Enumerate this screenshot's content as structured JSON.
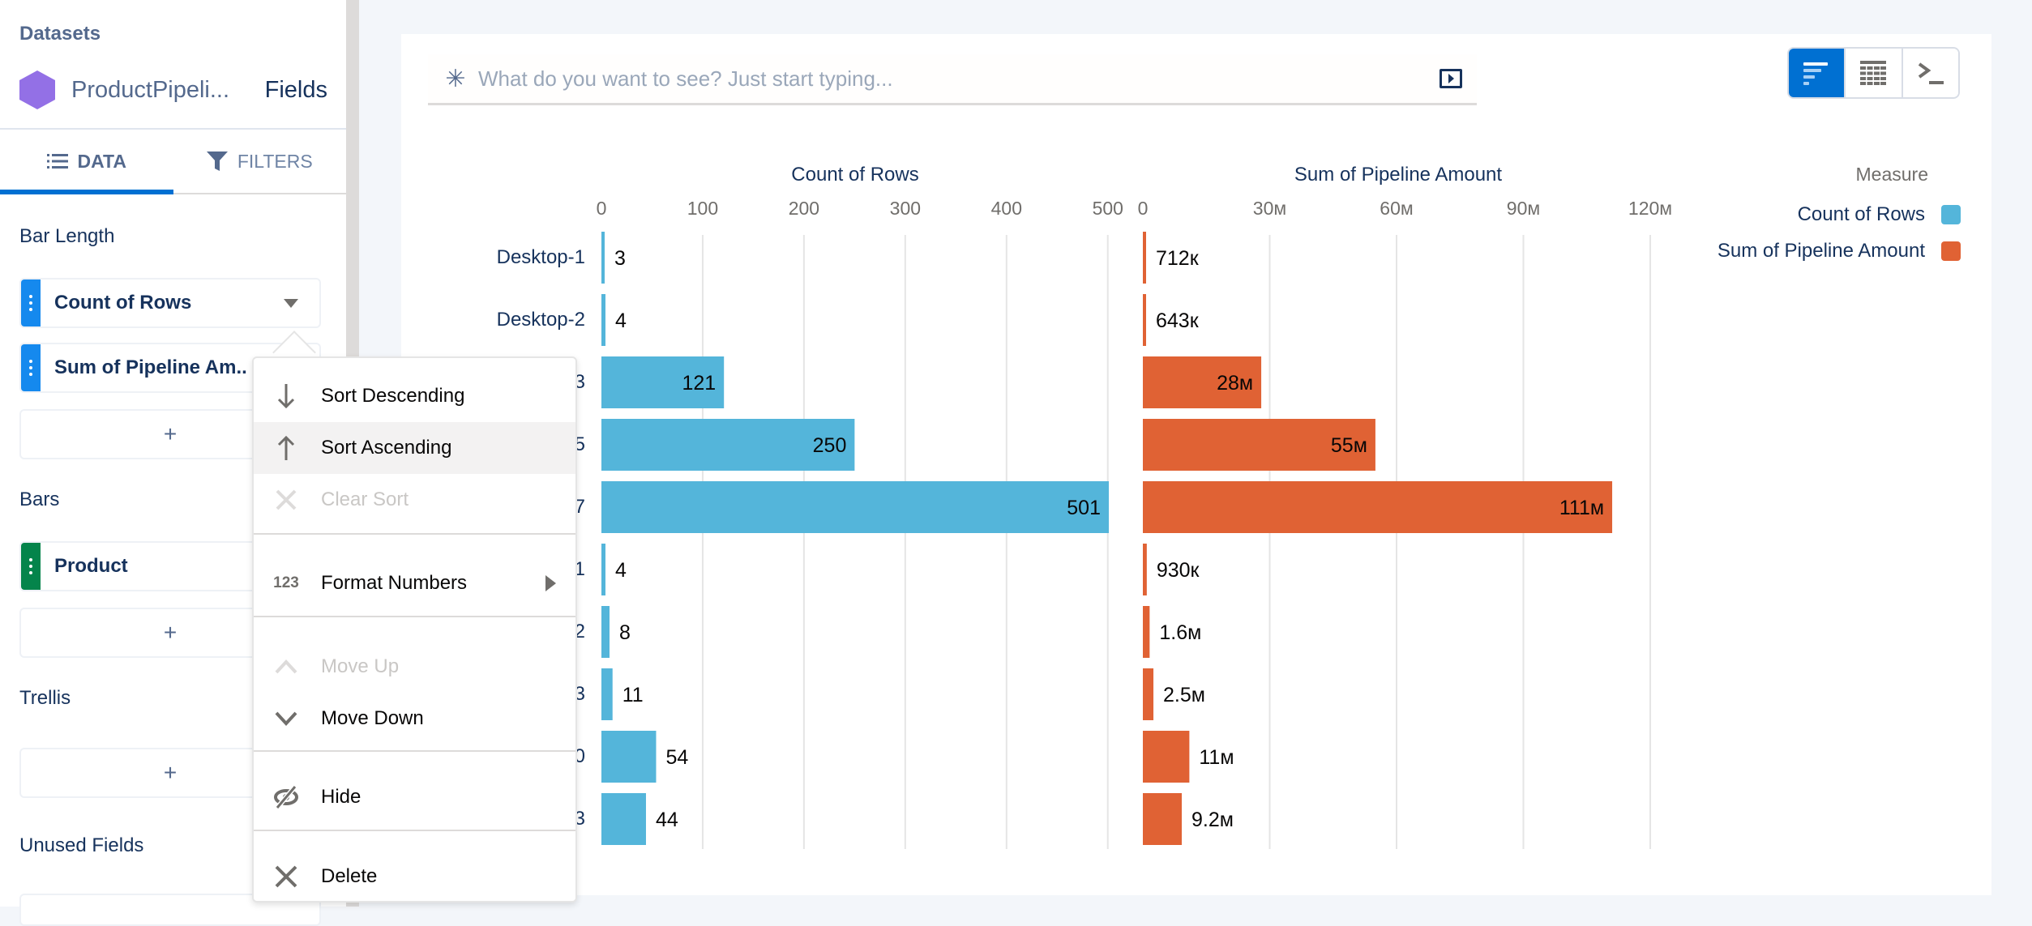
{
  "sidebar": {
    "datasets_label": "Datasets",
    "dataset_name": "ProductPipeli...",
    "fields_link": "Fields",
    "tabs": [
      {
        "label": "DATA",
        "icon": "list-icon",
        "active": true
      },
      {
        "label": "FILTERS",
        "icon": "filter-icon",
        "active": false
      }
    ],
    "sections": {
      "bar_length": {
        "label": "Bar Length",
        "fields": [
          {
            "label": "Count of Rows",
            "color": "#1589ee"
          },
          {
            "label": "Sum of Pipeline Am..",
            "color": "#1589ee"
          }
        ],
        "add_label": "+"
      },
      "bars": {
        "label": "Bars",
        "fields": [
          {
            "label": "Product",
            "color": "#04844b"
          }
        ],
        "add_label": "+"
      },
      "trellis": {
        "label": "Trellis",
        "add_label": "+"
      },
      "unused": {
        "label": "Unused Fields"
      }
    }
  },
  "search": {
    "placeholder": "What do you want to see? Just start typing...",
    "value": ""
  },
  "view_toggle": [
    {
      "name": "chart-view",
      "icon": "bar-chart-icon",
      "active": true
    },
    {
      "name": "table-view",
      "icon": "table-icon",
      "active": false
    },
    {
      "name": "query-view",
      "icon": "console-icon",
      "active": false
    }
  ],
  "menu": {
    "items": [
      {
        "label": "Sort Descending",
        "icon": "arrow-down-icon",
        "disabled": false,
        "hover": false
      },
      {
        "label": "Sort Ascending",
        "icon": "arrow-up-icon",
        "disabled": false,
        "hover": true
      },
      {
        "label": "Clear Sort",
        "icon": "close-icon",
        "disabled": true,
        "hover": false
      },
      {
        "label": "Format Numbers",
        "icon": "number-format-icon",
        "icon_text": "123",
        "disabled": false,
        "submenu": true
      },
      {
        "label": "Move Up",
        "icon": "chevron-up-icon",
        "disabled": true
      },
      {
        "label": "Move Down",
        "icon": "chevron-down-icon",
        "disabled": false
      },
      {
        "label": "Hide",
        "icon": "hide-icon",
        "disabled": false
      },
      {
        "label": "Delete",
        "icon": "delete-icon",
        "disabled": false
      }
    ]
  },
  "legend": {
    "title": "Measure",
    "items": [
      {
        "label": "Count of Rows",
        "color": "#54b5da"
      },
      {
        "label": "Sum of Pipeline Amount",
        "color": "#e06234"
      }
    ]
  },
  "chart_data": {
    "type": "bar",
    "orientation": "horizontal",
    "categories": [
      "Desktop-1",
      "Desktop-2",
      "3",
      "5",
      "7",
      "1",
      "2",
      "3",
      "0",
      "3"
    ],
    "categories_note": "Only trailing characters of rows 3-10 are visible; the rest is hidden behind the context menu",
    "panels": [
      {
        "title": "Count of Rows",
        "color": "#54b5da",
        "xlim": [
          0,
          520
        ],
        "ticks": [
          0,
          100,
          200,
          300,
          400,
          500
        ],
        "tick_labels": [
          "0",
          "100",
          "200",
          "300",
          "400",
          "500"
        ],
        "values": [
          3,
          4,
          121,
          250,
          501,
          4,
          8,
          11,
          54,
          44
        ],
        "labels": [
          "3",
          "4",
          "121",
          "250",
          "501",
          "4",
          "8",
          "11",
          "54",
          "44"
        ]
      },
      {
        "title": "Sum of Pipeline Amount",
        "color": "#e06234",
        "xlim": [
          0,
          125000000
        ],
        "ticks": [
          0,
          30000000,
          60000000,
          90000000,
          120000000
        ],
        "tick_labels": [
          "0",
          "30м",
          "60м",
          "90м",
          "120м"
        ],
        "values": [
          712000,
          643000,
          28000000,
          55000000,
          111000000,
          930000,
          1600000,
          2500000,
          11000000,
          9200000
        ],
        "labels": [
          "712к",
          "643к",
          "28м",
          "55м",
          "111м",
          "930к",
          "1.6м",
          "2.5м",
          "11м",
          "9.2м"
        ]
      }
    ],
    "grid": true,
    "legend": "top-right"
  }
}
